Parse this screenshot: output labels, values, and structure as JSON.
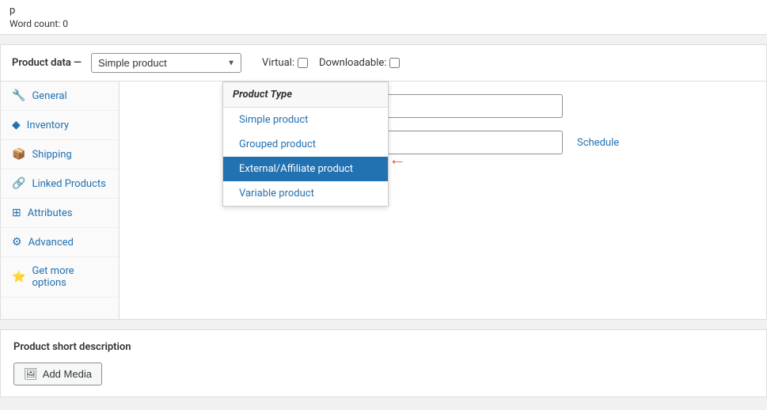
{
  "topbar": {
    "title": "p",
    "word_count_label": "Word count:",
    "word_count_value": "0"
  },
  "product_data": {
    "label": "Product data —",
    "select_value": "Simple product",
    "select_options": [
      "Simple product",
      "Grouped product",
      "External/Affiliate product",
      "Variable product"
    ],
    "virtual_label": "Virtual:",
    "downloadable_label": "Downloadable:"
  },
  "sidebar": {
    "items": [
      {
        "label": "General",
        "icon": "⚙"
      },
      {
        "label": "Inventory",
        "icon": "◆"
      },
      {
        "label": "Shipping",
        "icon": "📦"
      },
      {
        "label": "Linked Products",
        "icon": "🔗"
      },
      {
        "label": "Attributes",
        "icon": "⊞"
      },
      {
        "label": "Advanced",
        "icon": "⚙"
      },
      {
        "label": "Get more options",
        "icon": "⭐"
      }
    ]
  },
  "dropdown": {
    "header": "Product Type",
    "items": [
      {
        "label": "Simple product",
        "selected": false
      },
      {
        "label": "Grouped product",
        "selected": false
      },
      {
        "label": "External/Affiliate product",
        "selected": true
      },
      {
        "label": "Variable product",
        "selected": false
      }
    ]
  },
  "main_fields": {
    "field1": {
      "label": "",
      "placeholder": ""
    },
    "field2": {
      "label": "",
      "placeholder": "",
      "schedule_label": "Schedule"
    }
  },
  "short_description": {
    "label": "Product short description",
    "add_media_label": "Add Media"
  }
}
